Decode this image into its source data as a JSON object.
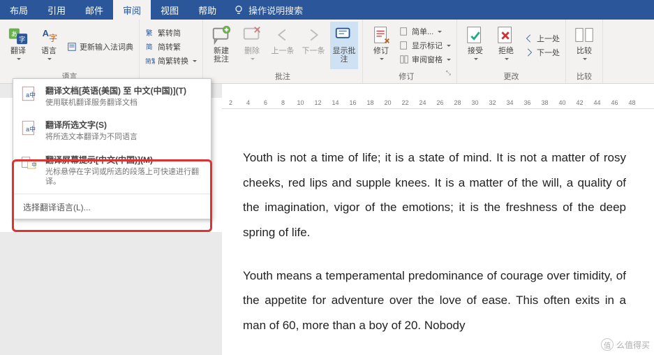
{
  "tabs": [
    "布局",
    "引用",
    "邮件",
    "审阅",
    "视图",
    "帮助"
  ],
  "activeTab": 3,
  "search": "操作说明搜索",
  "ribbon": {
    "g0": {
      "btn0": "翻译",
      "btn1": "语言",
      "row0": "更新输入法词典",
      "label": "语言"
    },
    "g1": {
      "r0": "繁转简",
      "r1": "简转繁",
      "r2": "简繁转换",
      "label": ""
    },
    "g2": {
      "b0": "新建\n批注",
      "b1": "删除",
      "b2": "上一条",
      "b3": "下一条",
      "b4": "显示批注",
      "label": "批注"
    },
    "g3": {
      "b0": "修订",
      "r0": "简单...",
      "r1": "显示标记",
      "r2": "审阅窗格",
      "label": "修订"
    },
    "g4": {
      "b0": "接受",
      "b1": "拒绝",
      "r0": "上一处",
      "r1": "下一处",
      "label": "更改"
    },
    "g5": {
      "b0": "比较",
      "label": "比较"
    }
  },
  "menu": {
    "i0": {
      "t": "翻译文档[英语(美国) 至 中文(中国)](T)",
      "d": "使用联机翻译服务翻译文档"
    },
    "i1": {
      "t": "翻译所选文字(S)",
      "d": "将所选文本翻译为不同语言"
    },
    "i2": {
      "t": "翻译屏幕提示[中文(中国)](M)",
      "d": "光标悬停在字词或所选的段落上可快速进行翻译。"
    },
    "lang": "选择翻译语言(L)..."
  },
  "rulerStart": 2,
  "rulerEnd": 48,
  "doc": {
    "p1": "Youth is not a time of life; it is a state of mind. It is not a matter of rosy cheeks, red lips and supple knees. It is a matter of the will, a quality of the imagination, vigor of the emotions; it is the freshness of the deep spring of life.",
    "p2": "Youth means a temperamental predominance of courage over timidity, of the appetite for adventure over the love of ease. This often exits in a man of 60, more than a boy of 20. Nobody"
  },
  "watermark": "么值得买"
}
